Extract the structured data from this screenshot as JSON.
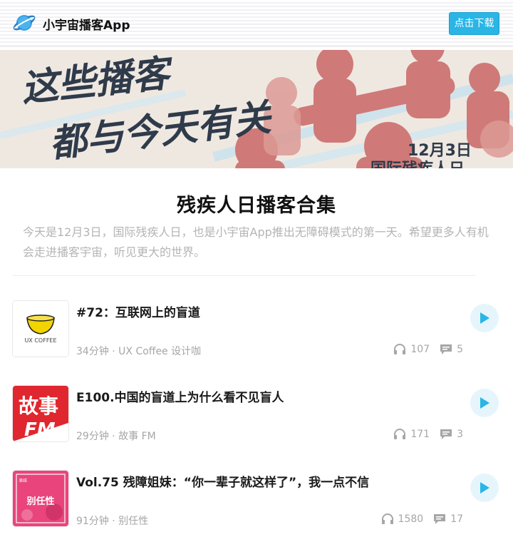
{
  "header": {
    "app_name": "小宇宙播客App",
    "download_label": "点击下载"
  },
  "banner": {
    "headline_line1": "这些播客",
    "headline_line2": "都与今天有关",
    "date_text": "12月3日",
    "event_text": "国际残疾人日"
  },
  "collection": {
    "title": "残疾人日播客合集",
    "description": "今天是12月3日，国际残疾人日，也是小宇宙App推出无障碍模式的第一天。希望更多人有机会走进播客宇宙，听见更大的世界。"
  },
  "episodes": [
    {
      "title": "#72：互联网上的盲道",
      "meta": "34分钟 · UX Coffee 设计咖",
      "plays": "107",
      "comments": "5",
      "cover_text": "UX COFFEE",
      "cover_icon": "coffee-cup-icon"
    },
    {
      "title": "E100.中国的盲道上为什么看不见盲人",
      "meta": "29分钟 · 故事 FM",
      "plays": "171",
      "comments": "3",
      "cover_text": "故事",
      "cover_text2": "FM",
      "cover_color": "#e0262e"
    },
    {
      "title": "Vol.75 残障姐妹：“你一辈子就这样了”，我一点不信",
      "meta": "91分钟 · 别任性",
      "plays": "1580",
      "comments": "17",
      "cover_text": "别任性",
      "cover_small": "BIE",
      "cover_color": "#e9457c"
    }
  ],
  "colors": {
    "accent": "#29b5e6",
    "play_bg": "#e6f5fb",
    "muted_text": "#a6a6a6"
  }
}
